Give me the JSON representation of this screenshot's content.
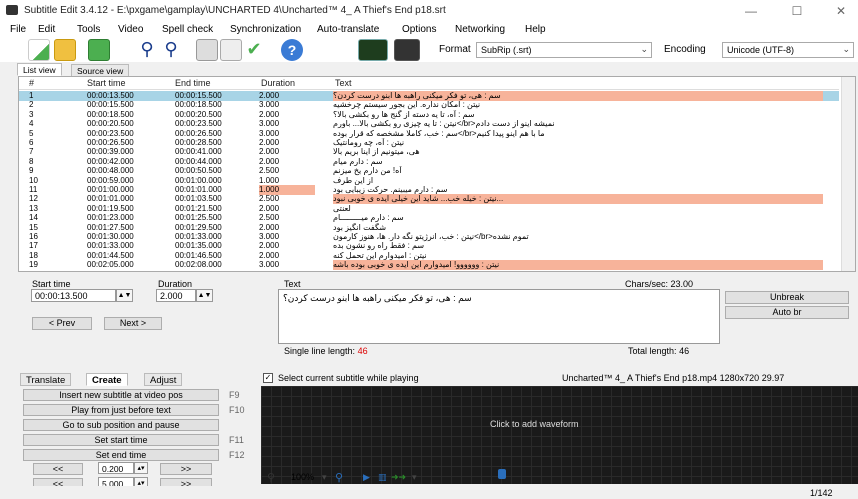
{
  "window": {
    "title": "Subtitle Edit 3.4.12 - E:\\pxgame\\gamplay\\UNCHARTED 4\\Uncharted™ 4_ A Thief's End p18.srt",
    "minimize": "—",
    "maximize": "☐",
    "close": "✕"
  },
  "menu": [
    "File",
    "Edit",
    "Tools",
    "Video",
    "Spell check",
    "Synchronization",
    "Auto-translate",
    "Options",
    "Networking",
    "Help"
  ],
  "toolbar": {
    "format_label": "Format",
    "format_value": "SubRip (.srt)",
    "encoding_label": "Encoding",
    "encoding_value": "Unicode (UTF-8)"
  },
  "view_tabs": [
    "List view",
    "Source view"
  ],
  "grid": {
    "columns": [
      "#",
      "Start time",
      "End time",
      "Duration",
      "Text"
    ],
    "rows": [
      {
        "n": "1",
        "start": "00:00:13.500",
        "end": "00:00:15.500",
        "dur": "2.000",
        "text": "سم : هی، تو فکر میکنی راهبه ها ابنو درست کردن؟",
        "state": "selected"
      },
      {
        "n": "2",
        "start": "00:00:15.500",
        "end": "00:00:18.500",
        "dur": "3.000",
        "text": "نیتن : امکان نداره. این بجور سیستم چرخشیه",
        "state": ""
      },
      {
        "n": "3",
        "start": "00:00:18.500",
        "end": "00:00:20.500",
        "dur": "2.000",
        "text": "سم : آه، تا یه دسته از گنج ها رو بکشی بالا؟",
        "state": ""
      },
      {
        "n": "4",
        "start": "00:00:20.500",
        "end": "00:00:23.500",
        "dur": "3.000",
        "text": "نمیشه اینو از دست دادم<br/>نیتن : تا یه چیزی رو بکشی بالا... باورم",
        "state": ""
      },
      {
        "n": "5",
        "start": "00:00:23.500",
        "end": "00:00:26.500",
        "dur": "3.000",
        "text": "ما با هم اینو پیدا کنیم<br/>سم : خب، کاملا مشخصه که قرار بوده",
        "state": ""
      },
      {
        "n": "6",
        "start": "00:00:26.500",
        "end": "00:00:28.500",
        "dur": "2.000",
        "text": "نیتن : آه، چه رومانتیک",
        "state": ""
      },
      {
        "n": "7",
        "start": "00:00:39.000",
        "end": "00:00:41.000",
        "dur": "2.000",
        "text": "هی، میتونیم از اینا بریم بالا",
        "state": ""
      },
      {
        "n": "8",
        "start": "00:00:42.000",
        "end": "00:00:44.000",
        "dur": "2.000",
        "text": "سم : دارم میام",
        "state": ""
      },
      {
        "n": "9",
        "start": "00:00:48.000",
        "end": "00:00:50.500",
        "dur": "2.500",
        "text": "آه! من دارم یخ میزنم",
        "state": ""
      },
      {
        "n": "10",
        "start": "00:00:59.000",
        "end": "00:01:00.000",
        "dur": "1.000",
        "text": "از این طرف",
        "state": ""
      },
      {
        "n": "11",
        "start": "00:01:00.000",
        "end": "00:01:01.000",
        "dur": "1.000",
        "text": "سم : دارم میبینم. حرکت زیبایی بود",
        "state": "durwarn"
      },
      {
        "n": "12",
        "start": "00:01:01.000",
        "end": "00:01:03.500",
        "dur": "2.500",
        "text": "...نیتن : خیله خب... شاید این خیلی ایده ی خوبی نبود",
        "state": "warn"
      },
      {
        "n": "13",
        "start": "00:01:19.500",
        "end": "00:01:21.500",
        "dur": "2.000",
        "text": "لعنتی",
        "state": ""
      },
      {
        "n": "14",
        "start": "00:01:23.000",
        "end": "00:01:25.500",
        "dur": "2.500",
        "text": "سم : دارم میـــــــــام",
        "state": ""
      },
      {
        "n": "15",
        "start": "00:01:27.500",
        "end": "00:01:29.500",
        "dur": "2.000",
        "text": "شگفت انگیز بود",
        "state": ""
      },
      {
        "n": "16",
        "start": "00:01:30.000",
        "end": "00:01:33.000",
        "dur": "3.000",
        "text": "تموم نشده<br/>نیتن : خب، انرژیتو نگه دار. ها، هنوز کارمون",
        "state": ""
      },
      {
        "n": "17",
        "start": "00:01:33.000",
        "end": "00:01:35.000",
        "dur": "2.000",
        "text": "سم : فقط راه رو نشون بده",
        "state": ""
      },
      {
        "n": "18",
        "start": "00:01:44.500",
        "end": "00:01:46.500",
        "dur": "2.000",
        "text": "نیتن : امیدوارم این تحمل کنه",
        "state": ""
      },
      {
        "n": "19",
        "start": "00:02:05.000",
        "end": "00:02:08.000",
        "dur": "3.000",
        "text": "نیتن : وووووو! امیدوارم این ایده ی خوبی بوده باشه",
        "state": "warn"
      }
    ]
  },
  "edit": {
    "start_time_label": "Start time",
    "start_time_value": "00:00:13.500",
    "duration_label": "Duration",
    "duration_value": "2.000",
    "text_label": "Text",
    "chars_sec": "Chars/sec: 23.00",
    "text_value": "سم : هی، تو فکر میکنی راهبه ها ابنو درست کردن؟",
    "prev_button": "< Prev",
    "next_button": "Next >",
    "unbreak_button": "Unbreak",
    "autobr_button": "Auto br",
    "single_line_label": "Single line length:",
    "single_line_value": "46",
    "total_length_label": "Total length:",
    "total_length_value": "46"
  },
  "bottom_tabs": [
    "Translate",
    "Create",
    "Adjust"
  ],
  "create": {
    "buttons": [
      {
        "label": "Insert new subtitle at video pos",
        "key": "F9"
      },
      {
        "label": "Play from just before text",
        "key": "F10"
      },
      {
        "label": "Go to sub position and pause",
        "key": ""
      },
      {
        "label": "Set start time",
        "key": "F11"
      },
      {
        "label": "Set end time",
        "key": "F12"
      }
    ],
    "step1": "0.200",
    "step2": "5.000",
    "back_label": "<<",
    "fwd_label": ">>"
  },
  "video": {
    "select_current_label": "Select current subtitle while playing",
    "file_info": "Uncharted™ 4_ A Thief's End p18.mp4 1280x720 29.97",
    "waveform_hint": "Click to add waveform",
    "zoom_value": "100%"
  },
  "status": {
    "position": "1/142"
  },
  "colors": {
    "selected_row": "#a8d4e6",
    "warn_row": "#f7b39a",
    "warn_cell": "#f7b39a"
  }
}
